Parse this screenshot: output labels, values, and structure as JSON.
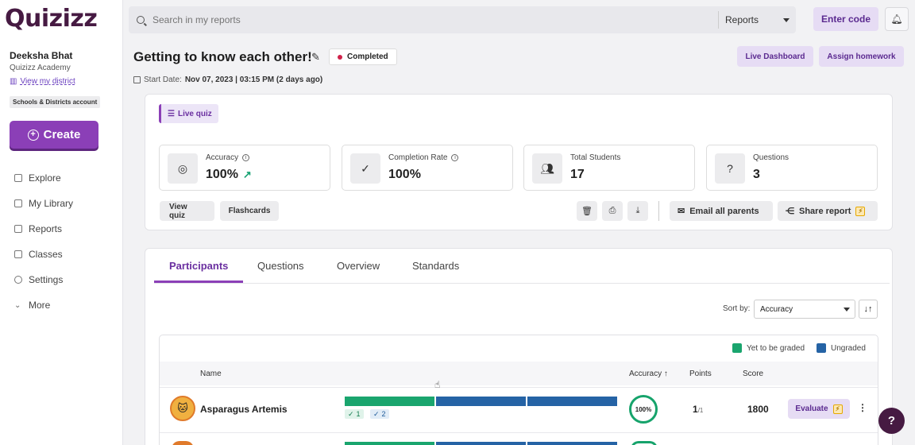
{
  "app": {
    "logo": "Quizizz"
  },
  "sidebar": {
    "user_name": "Deeksha Bhat",
    "org": "Quizizz Academy",
    "district_link": "View my district",
    "account_badge": "Schools & Districts account",
    "create_label": "Create",
    "items": [
      {
        "label": "Explore",
        "icon": "compass-icon"
      },
      {
        "label": "My Library",
        "icon": "library-icon"
      },
      {
        "label": "Reports",
        "icon": "reports-icon"
      },
      {
        "label": "Classes",
        "icon": "classes-icon"
      },
      {
        "label": "Settings",
        "icon": "gear-icon"
      },
      {
        "label": "More",
        "icon": "chevron-down-icon"
      }
    ]
  },
  "topbar": {
    "search_placeholder": "Search in my reports",
    "scope": "Reports",
    "enter_code": "Enter code"
  },
  "report": {
    "title": "Getting to know each other!",
    "status": "Completed",
    "start_label": "Start Date:",
    "start_value": "Nov 07, 2023 | 03:15 PM (2 days ago)",
    "live_dashboard": "Live Dashboard",
    "assign_homework": "Assign homework",
    "quiz_type": "Live quiz",
    "stats": [
      {
        "label": "Accuracy",
        "value": "100%"
      },
      {
        "label": "Completion Rate",
        "value": "100%"
      },
      {
        "label": "Total Students",
        "value": "17"
      },
      {
        "label": "Questions",
        "value": "3"
      }
    ],
    "view_quiz": "View quiz",
    "flashcards": "Flashcards",
    "email_parents": "Email all parents",
    "share_report": "Share report"
  },
  "tabs": [
    "Participants",
    "Questions",
    "Overview",
    "Standards"
  ],
  "sort": {
    "label": "Sort by:",
    "value": "Accuracy"
  },
  "legend": {
    "yet_to_grade": "Yet to be graded",
    "ungraded": "Ungraded"
  },
  "colors": {
    "green": "#1aa56e",
    "blue": "#2563a5",
    "accent": "#8b3fb7"
  },
  "table": {
    "headers": {
      "name": "Name",
      "accuracy": "Accuracy",
      "points": "Points",
      "score": "Score"
    },
    "rows": [
      {
        "name": "Asparagus Artemis",
        "green_count": "1",
        "blue_count": "2",
        "accuracy": "100%",
        "points": "1",
        "points_total": "/1",
        "score": "1800",
        "evaluate": "Evaluate"
      }
    ]
  },
  "help": "?"
}
